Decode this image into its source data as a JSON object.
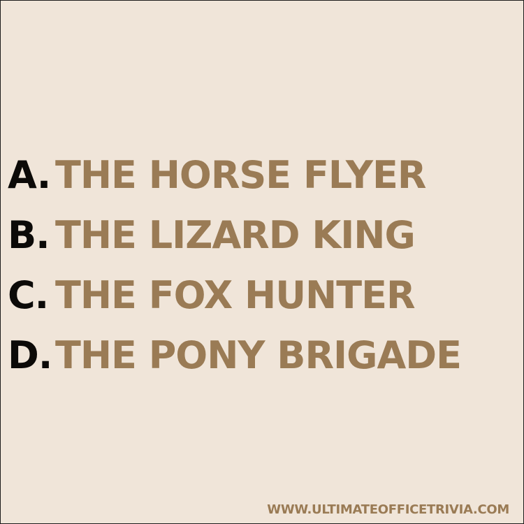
{
  "colors": {
    "background": "#f0e5d9",
    "border": "#1c1c1c",
    "letter": "#0c0a08",
    "answer_text": "#9a7b55"
  },
  "options": [
    {
      "letter": "A.",
      "text": "THE HORSE FLYER"
    },
    {
      "letter": "B.",
      "text": "THE LIZARD KING"
    },
    {
      "letter": "C.",
      "text": "THE FOX HUNTER"
    },
    {
      "letter": "D.",
      "text": "THE PONY BRIGADE"
    }
  ],
  "footer": {
    "website": "WWW.ULTIMATEOFFICETRIVIA.COM"
  }
}
